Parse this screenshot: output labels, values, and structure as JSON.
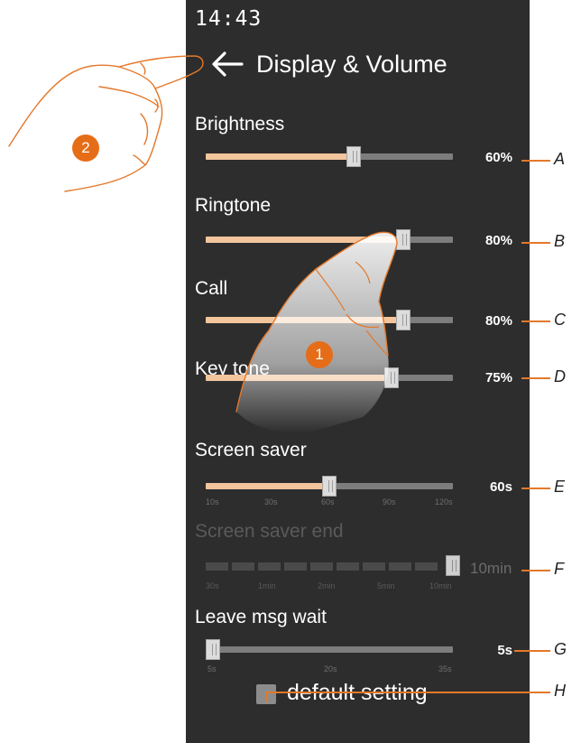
{
  "status": {
    "time": "14:43"
  },
  "header": {
    "title": "Display & Volume",
    "back_icon": "arrow-left-icon"
  },
  "settings": [
    {
      "id": "brightness",
      "label": "Brightness",
      "value": "60%",
      "level": 0.6,
      "letter": "A"
    },
    {
      "id": "ringtone",
      "label": "Ringtone",
      "value": "80%",
      "level": 0.8,
      "letter": "B"
    },
    {
      "id": "call",
      "label": "Call",
      "value": "80%",
      "level": 0.8,
      "letter": "C"
    },
    {
      "id": "key-tone",
      "label": "Key tone",
      "value": "75%",
      "level": 0.75,
      "letter": "D"
    },
    {
      "id": "screen-saver",
      "label": "Screen saver",
      "value": "60s",
      "level": 0.5,
      "letter": "E",
      "ticks": [
        "10s",
        "30s",
        "60s",
        "90s",
        "120s"
      ]
    },
    {
      "id": "screen-saver-end",
      "label": "Screen saver end",
      "value": "10min",
      "level": 1.0,
      "letter": "F",
      "disabled": true,
      "ticks": [
        "30s",
        "1min",
        "2min",
        "5min",
        "10min"
      ]
    },
    {
      "id": "leave-msg-wait",
      "label": "Leave msg wait",
      "value": "5s",
      "level": 0.0,
      "letter": "G",
      "ticks": [
        "5s",
        "20s",
        "35s"
      ]
    }
  ],
  "footer": {
    "default_label": "default setting",
    "letter": "H",
    "checked": false
  },
  "annotations": {
    "badge_1": "1",
    "badge_2": "2"
  },
  "colors": {
    "accent": "#f2c59c",
    "callout": "#e4782a",
    "badge": "#e66d18",
    "panel": "#2d2d2d"
  }
}
